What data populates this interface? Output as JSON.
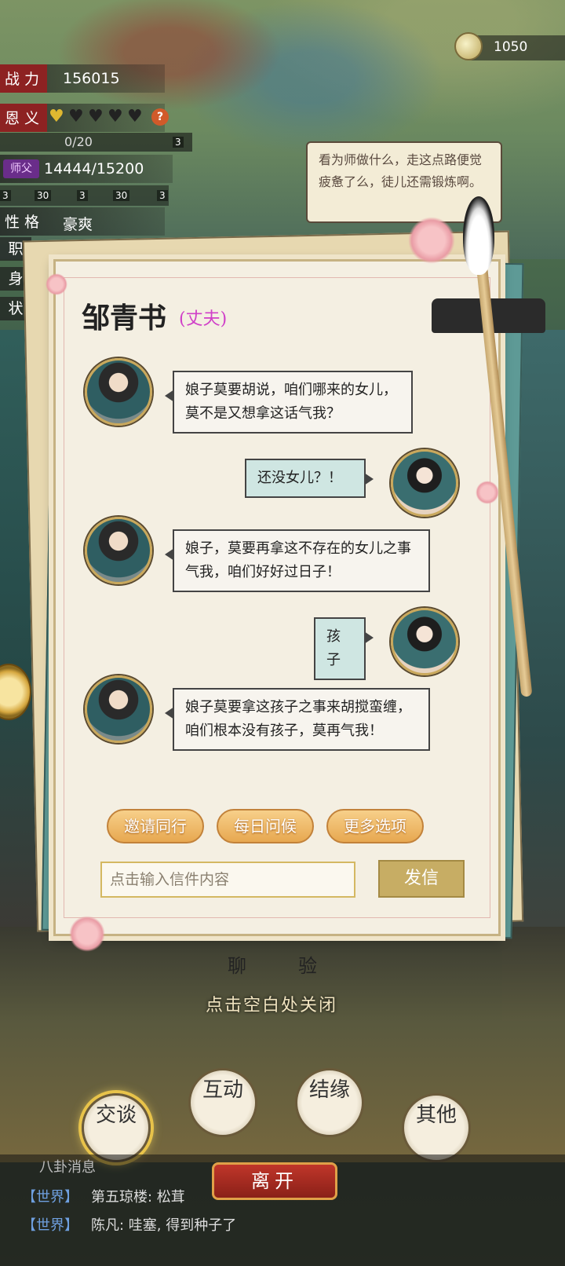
{
  "stats": {
    "power_label": "战 力",
    "power_value": "156015",
    "favor_label": "恩 义",
    "favor_hearts": 1,
    "favor_hearts_total": 5,
    "favor_progress": "0/20",
    "favor_badge": "3",
    "master_tag": "师父",
    "master_value": "14444/15200",
    "item_badges": [
      "3",
      "30",
      "3",
      "30",
      "3"
    ],
    "personality_label": "性 格",
    "personality_value": "豪爽",
    "side_labels": [
      "职",
      "身",
      "状"
    ]
  },
  "resource": {
    "icon": "tea-bowl-icon",
    "value": "1050"
  },
  "npc_speech": "看为师做什么，走这点路便觉疲惫了么，徒儿还需锻炼啊。",
  "letter": {
    "name": "邹青书",
    "relation": "(丈夫)",
    "messages": [
      {
        "from": "npc",
        "text": "娘子莫要胡说，咱们哪来的女儿，莫不是又想拿这话气我？"
      },
      {
        "from": "player",
        "text": "还没女儿？！"
      },
      {
        "from": "npc",
        "text": "娘子，莫要再拿这不存在的女儿之事气我，咱们好好过日子！"
      },
      {
        "from": "player",
        "text": "孩子"
      },
      {
        "from": "npc",
        "text": "娘子莫要拿这孩子之事来胡搅蛮缠，咱们根本没有孩子，莫再气我！"
      }
    ],
    "options": [
      "邀请同行",
      "每日问候",
      "更多选项"
    ],
    "input_placeholder": "点击输入信件内容",
    "send_label": "发信"
  },
  "bottom": {
    "tab_chat": "聊",
    "tab_exp": "验",
    "close_hint": "点击空白处关闭",
    "menu": [
      {
        "label": "交谈",
        "active": true
      },
      {
        "label": "互动",
        "active": false
      },
      {
        "label": "结缘",
        "active": false
      },
      {
        "label": "其他",
        "active": false
      }
    ],
    "leave_label": "离开"
  },
  "chat": {
    "hint": "八卦消息",
    "lines": [
      {
        "tag": "【世界】",
        "text": "第五琼楼: 松茸"
      },
      {
        "tag": "【世界】",
        "text": "陈凡: 哇塞, 得到种子了"
      }
    ]
  },
  "colors": {
    "accent": "#e7a850",
    "relation": "#d040c8",
    "player_bubble": "#cfe6e2",
    "leave_btn": "#c0362a"
  }
}
